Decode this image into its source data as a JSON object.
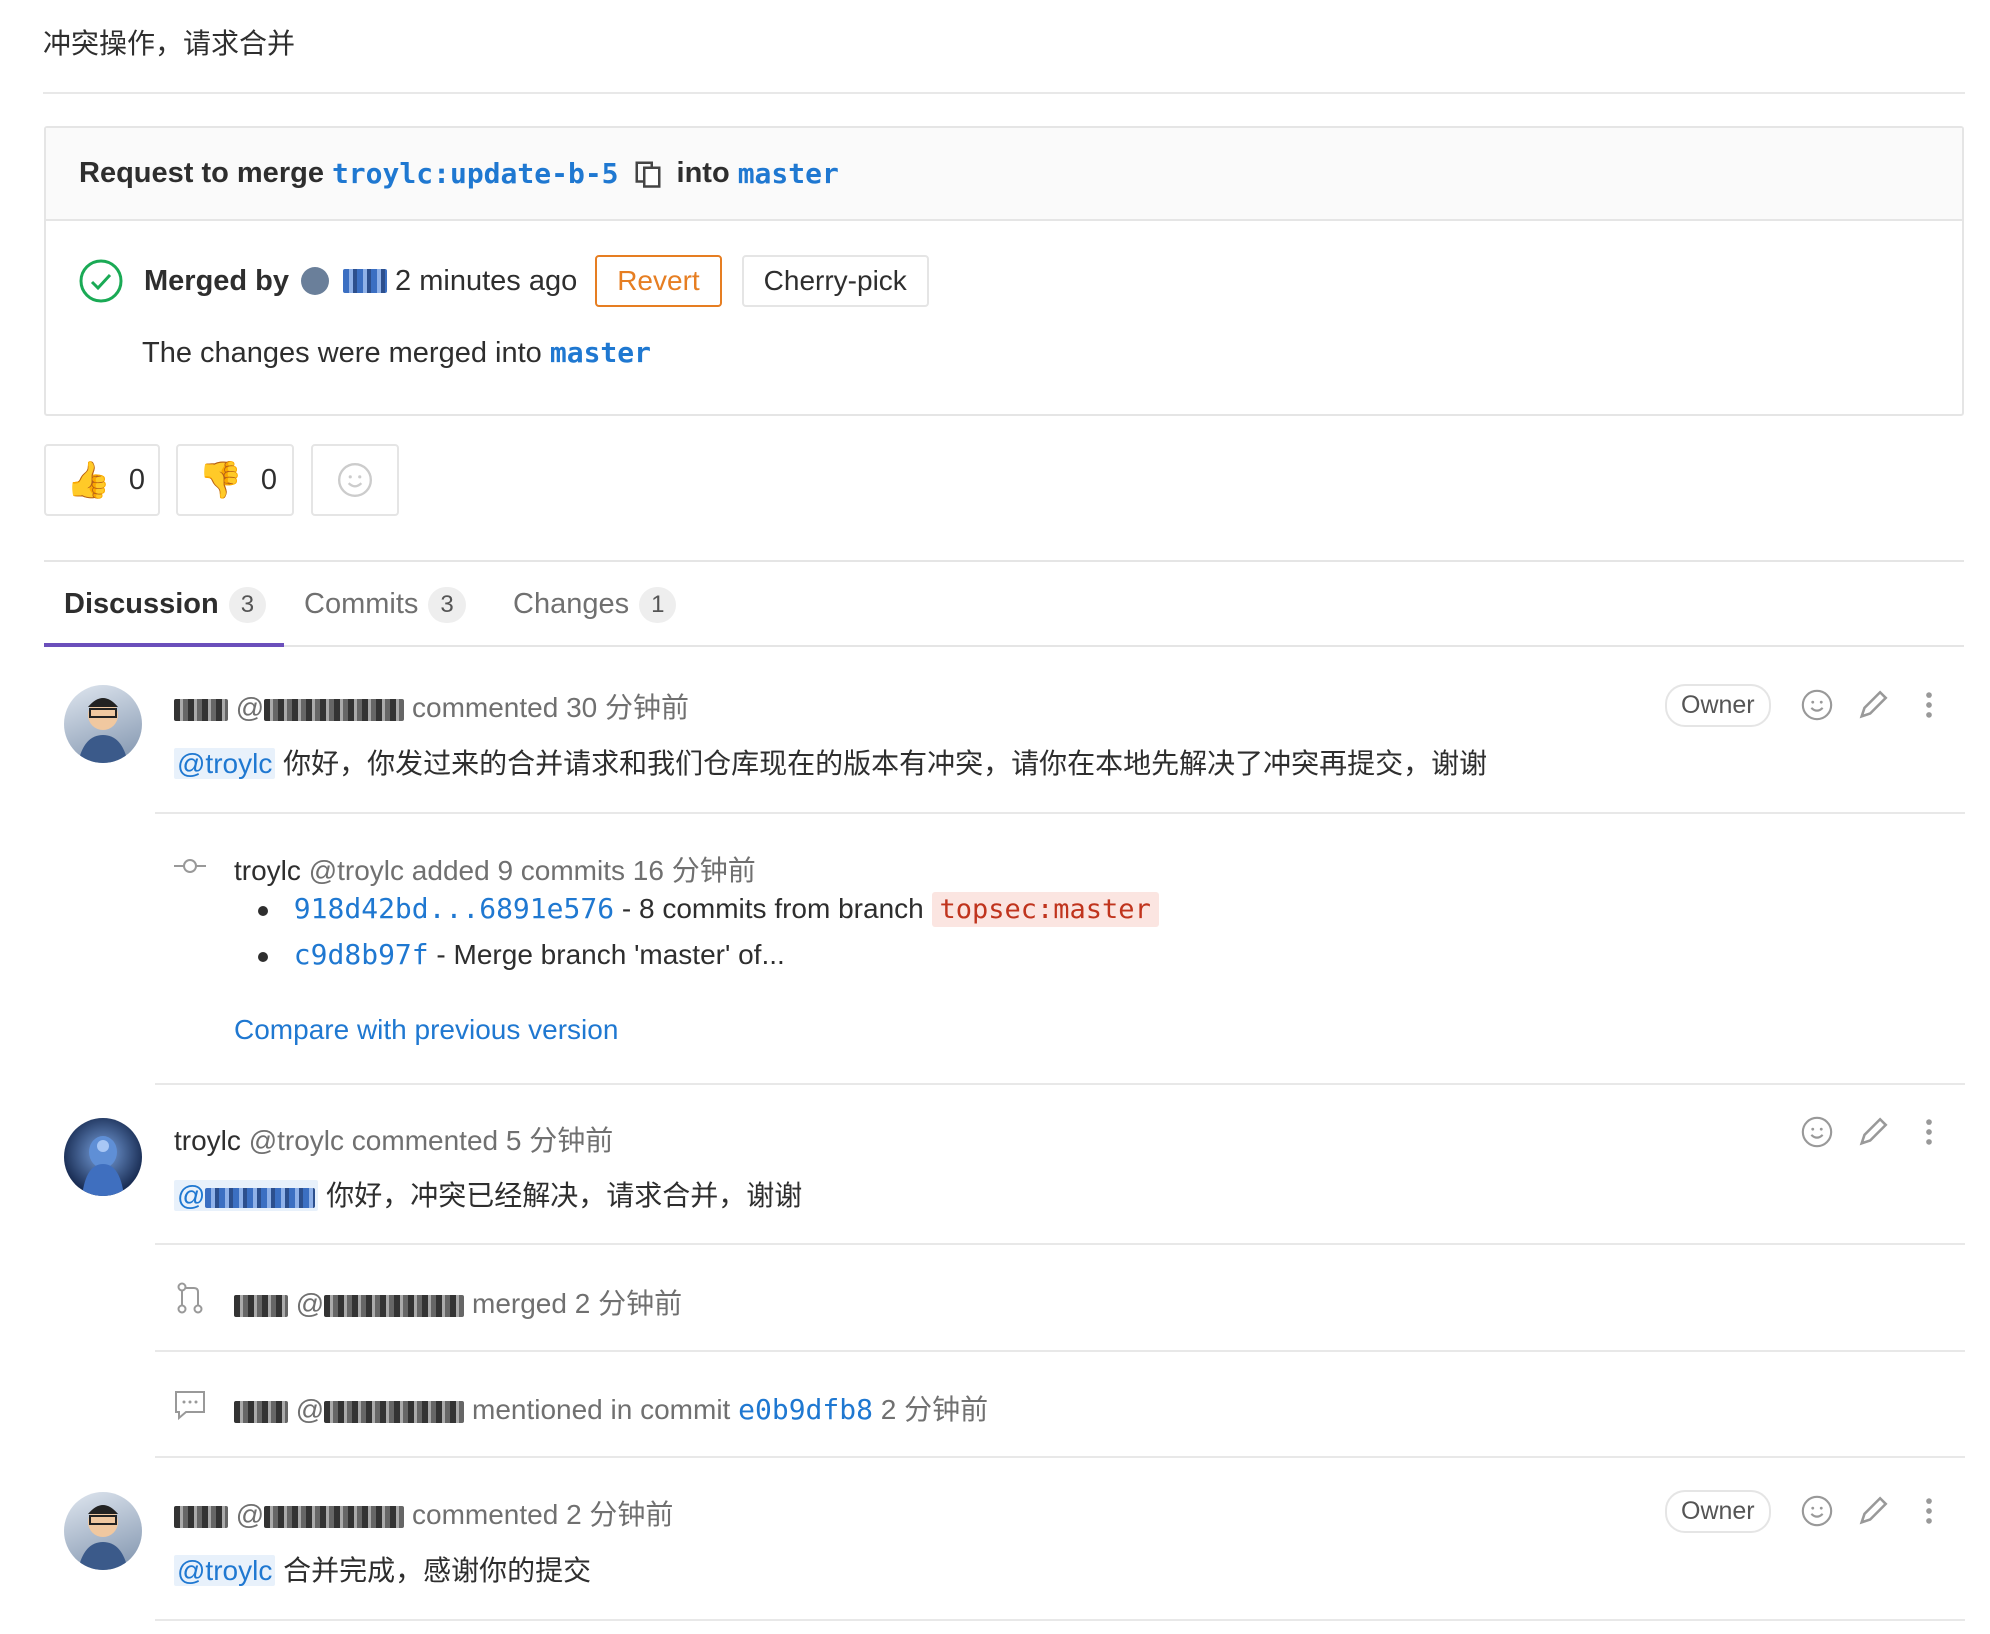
{
  "description": "冲突操作，请求合并",
  "merge_widget": {
    "header_prefix": "Request to merge",
    "source_branch": "troylc:update-b-5",
    "header_into": "into",
    "target_branch": "master",
    "merged_by_label": "Merged by",
    "merged_time": "2 minutes ago",
    "revert_label": "Revert",
    "cherry_pick_label": "Cherry-pick",
    "merged_info_prefix": "The changes were merged into",
    "merged_info_branch": "master"
  },
  "awards": {
    "thumbsup_count": "0",
    "thumbsdown_count": "0"
  },
  "tabs": [
    {
      "label": "Discussion",
      "count": "3"
    },
    {
      "label": "Commits",
      "count": "3"
    },
    {
      "label": "Changes",
      "count": "1"
    }
  ],
  "notes": {
    "n1": {
      "author": "",
      "handle": "@",
      "action": "commented 30 分钟前",
      "badge": "Owner",
      "mention": "@troylc",
      "text": "你好，你发过来的合并请求和我们仓库现在的版本有冲突，请你在本地先解决了冲突再提交，谢谢"
    },
    "sys1": {
      "author": "troylc",
      "handle": "@troylc",
      "action": "added 9 commits 16 分钟前",
      "commit1_range": "918d42bd...6891e576",
      "commit1_text": "- 8 commits from branch",
      "commit1_branch": "topsec:master",
      "commit2_sha": "c9d8b97f",
      "commit2_text": "- Merge branch 'master' of...",
      "compare_link": "Compare with previous version"
    },
    "n2": {
      "author": "troylc",
      "handle": "@troylc",
      "action": "commented 5 分钟前",
      "mention": "@",
      "text": "你好，冲突已经解决，请求合并，谢谢"
    },
    "sys2": {
      "handle": "@",
      "action": "merged 2 分钟前"
    },
    "sys3": {
      "handle": "@",
      "action": "mentioned in commit",
      "commit": "e0b9dfb8",
      "time": "2 分钟前"
    },
    "n3": {
      "handle": "@",
      "action": "commented 2 分钟前",
      "badge": "Owner",
      "mention": "@troylc",
      "text": "合并完成，感谢你的提交"
    }
  }
}
